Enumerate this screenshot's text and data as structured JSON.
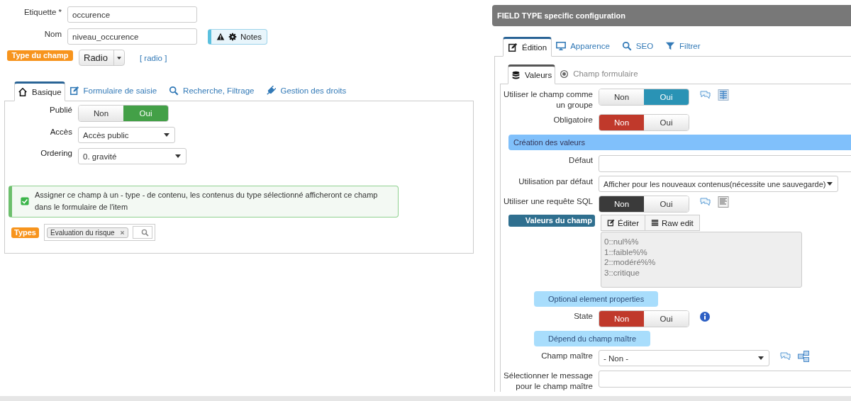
{
  "form": {
    "fields": [
      {
        "label": "Etiquette *",
        "value": "occurence"
      },
      {
        "label": "Nom",
        "value": "niveau_occurence"
      }
    ],
    "notes_button": {
      "label": "Notes"
    },
    "field_type": {
      "badge": "Type du champ",
      "value": "Radio",
      "code": "[ radio ]"
    }
  },
  "left_tabs": [
    {
      "label": "Basique",
      "selected": true
    },
    {
      "label": "Formulaire de saisie",
      "selected": false
    },
    {
      "label": "Recherche, Filtrage",
      "selected": false
    },
    {
      "label": "Gestion des droits",
      "selected": false
    }
  ],
  "basic": {
    "rows": [
      {
        "kind": "toggle",
        "label": "Publié",
        "options": [
          {
            "label": "Non",
            "selected": false
          },
          {
            "label": "Oui",
            "selected": true
          }
        ]
      },
      {
        "kind": "select",
        "label": "Accès",
        "value": "Accès public"
      },
      {
        "kind": "select",
        "label": "Ordering",
        "value": "0. gravité"
      }
    ],
    "alert": {
      "text": "Assigner ce champ à un - type - de contenu, les contenus du type sélectionné afficheront ce champ dans le formulaire de l'item",
      "checked": true
    },
    "types": {
      "badge": "Types",
      "tags": [
        {
          "label": "Evaluation du risque"
        }
      ]
    }
  },
  "config": {
    "title": "FIELD TYPE specific configuration",
    "tabs": [
      {
        "label": "Édition",
        "selected": true
      },
      {
        "label": "Apparence",
        "selected": false
      },
      {
        "label": "SEO",
        "selected": false
      },
      {
        "label": "Filtrer",
        "selected": false
      }
    ],
    "subtabs": [
      {
        "label": "Valeurs",
        "selected": true
      },
      {
        "label": "Champ formulaire",
        "selected": false
      }
    ],
    "rows": [
      {
        "kind": "toggle",
        "label": "Utiliser le champ comme un groupe",
        "options": [
          {
            "label": "Non",
            "selected": false
          },
          {
            "label": "Oui",
            "selected": true
          }
        ]
      },
      {
        "kind": "toggle",
        "label": "Obligatoire",
        "options": [
          {
            "label": "Non",
            "selected": true
          },
          {
            "label": "Oui",
            "selected": false
          }
        ]
      },
      {
        "kind": "section",
        "label": "Création des valeurs"
      },
      {
        "kind": "input",
        "label": "Défaut"
      },
      {
        "kind": "select",
        "label": "Utilisation par défaut",
        "value": "Afficher pour les nouveaux contenus(nécessite une sauvegarde)"
      },
      {
        "kind": "toggle",
        "label": "Utiliser une requête SQL",
        "options": [
          {
            "label": "Non",
            "selected": true
          },
          {
            "label": "Oui",
            "selected": false
          }
        ]
      },
      {
        "kind": "values",
        "label": "Valeurs du champ",
        "buttons": [
          "Éditer",
          "Raw edit"
        ],
        "lines": [
          "0::nul%%",
          "1::faible%%",
          "2::modéré%%",
          "3::critique"
        ]
      },
      {
        "kind": "pill",
        "label": "Optional element properties"
      },
      {
        "kind": "toggle",
        "label": "State",
        "options": [
          {
            "label": "Non",
            "selected": true
          },
          {
            "label": "Oui",
            "selected": false
          }
        ]
      },
      {
        "kind": "pill",
        "label": "Dépend du champ maître"
      },
      {
        "kind": "select",
        "label": "Champ maître",
        "value": "- Non -"
      },
      {
        "kind": "input",
        "label": "Sélectionner le message pour le champ maître"
      }
    ]
  }
}
